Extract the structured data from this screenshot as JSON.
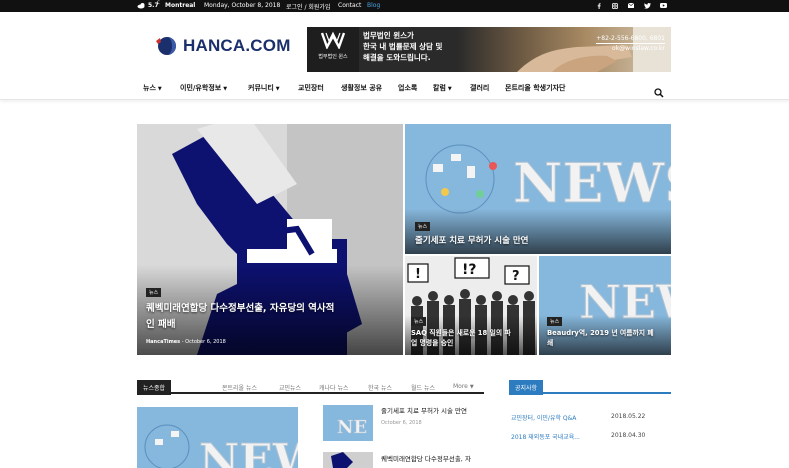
{
  "topbar": {
    "temperature": "5.7",
    "unit": "C",
    "city": "Montreal",
    "date": "Monday, October 8, 2018",
    "links": [
      "로그인 / 회원가입",
      "Contact",
      "Blog"
    ],
    "social_icons": [
      "facebook-icon",
      "instagram-icon",
      "mail-icon",
      "twitter-icon",
      "youtube-icon"
    ]
  },
  "header": {
    "logo_text": "HANCA.COM",
    "banner": {
      "firm_label": "법무법인 윈스",
      "line1": "법무법인 윈스가",
      "line2": "한국 내 법률문제 상담 및",
      "line3": "해결을 도와드립니다.",
      "phone": "+82-2-556-6800, 6801",
      "email": "ok@winslaw.co.kr"
    }
  },
  "nav": {
    "items": [
      "뉴스",
      "이민/유학정보",
      "커뮤니티",
      "교민장터",
      "생활정보 공유",
      "업소록",
      "칼럼",
      "갤러리",
      "몬트리올 학생기자단"
    ]
  },
  "featured": {
    "main": {
      "category": "뉴스",
      "title_line1": "퀘벡미래연합당 다수정부선출, 자유당의 역사적",
      "title_line2": "인 패배",
      "author": "HancaTimes",
      "date": "October 6, 2018"
    },
    "top_right": {
      "category": "뉴스",
      "title": "줄기세포 치료 무허가 시술 만연"
    },
    "bottom_left": {
      "category": "뉴스",
      "title_line1": "SAQ 직원들은 새로운 18 일의 파",
      "title_line2": "업 명령을 승인"
    },
    "bottom_right": {
      "category": "뉴스",
      "title_line1": "Beaudry역, 2019 년 여름까지 폐",
      "title_line2": "쇄"
    }
  },
  "news_section": {
    "title": "뉴스종합",
    "tabs": [
      "몬트리올 뉴스",
      "교민뉴스",
      "캐나다 뉴스",
      "한국 뉴스",
      "월드 뉴스",
      "More"
    ],
    "items": [
      {
        "title": "줄기세포 치료 무허가 시술 만연",
        "date": "October 6, 2018"
      },
      {
        "title": "퀘벡미래연합당 다수정부선출, 자",
        "date": ""
      }
    ]
  },
  "notice": {
    "title": "공지사항",
    "rows": [
      {
        "label": "교민장터, 이민/유학 Q&A",
        "date": "2018.05.22"
      },
      {
        "label": "2018 재외동포 국내교육...",
        "date": "2018.04.30"
      }
    ]
  },
  "colors": {
    "brand_navy": "#1a2f6b",
    "notice_blue": "#2d7cc0",
    "sky_blue": "#7fb2d9"
  }
}
